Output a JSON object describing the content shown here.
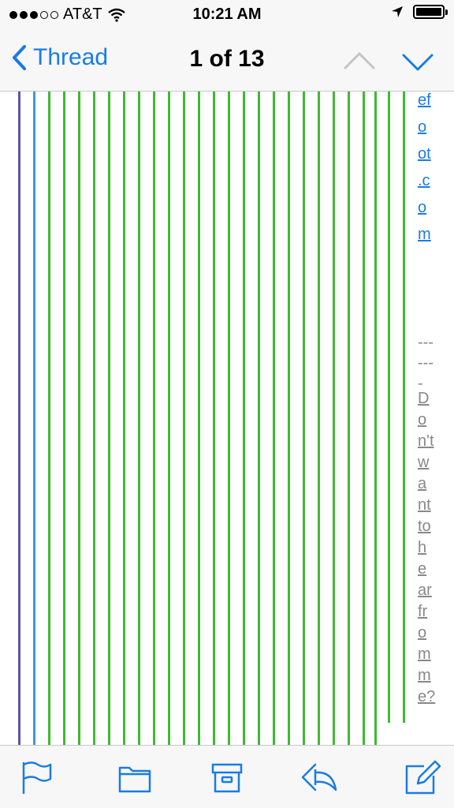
{
  "status_bar": {
    "carrier": "AT&T",
    "time": "10:21 AM"
  },
  "nav": {
    "back_label": "Thread",
    "title": "1 of 13"
  },
  "content": {
    "thread_line_colors": [
      "#5b57a8",
      "#3a9be0",
      "#3fba31"
    ],
    "link_fragment": [
      "ef",
      "o",
      "ot",
      ".c",
      "o",
      "m"
    ],
    "separator": [
      "---",
      "---",
      "-"
    ],
    "footer_link": [
      "D",
      "o",
      "n't",
      "w",
      "a",
      "nt",
      "to",
      "h",
      "e",
      "ar",
      "fr",
      "o",
      "m",
      "m",
      "e?"
    ]
  },
  "toolbar": {
    "icons": [
      "flag-icon",
      "folder-icon",
      "archive-icon",
      "reply-icon",
      "compose-icon"
    ]
  },
  "colors": {
    "accent": "#1a7ce2",
    "thread_green": "#3fba31",
    "thread_blue": "#3a9be0",
    "thread_purple": "#5b57a8"
  }
}
